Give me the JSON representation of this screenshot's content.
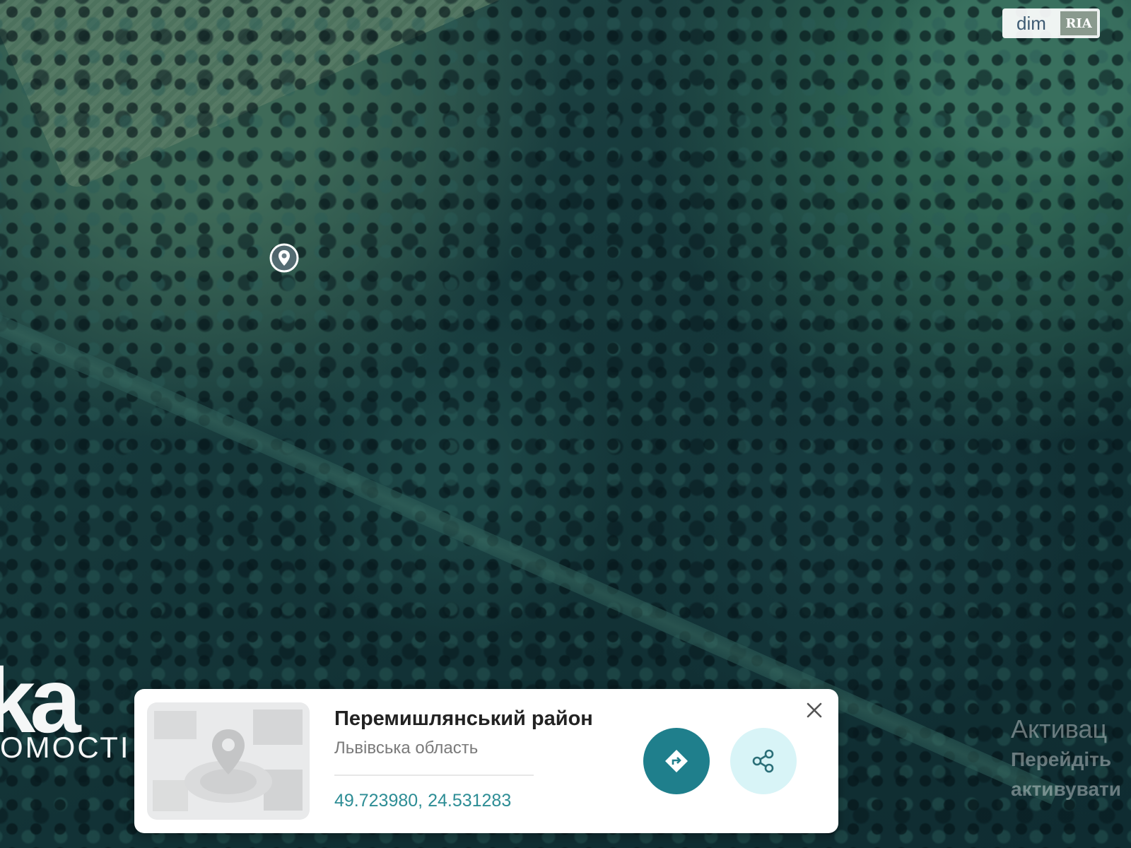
{
  "map": {
    "view": "satellite",
    "marker_icon": "location-pin-icon"
  },
  "watermark": {
    "brand_text": "dim",
    "logo_text": "RIA"
  },
  "overlay_logo": {
    "line1": "ka",
    "line2": "ОМОСТІ"
  },
  "activation_notice": {
    "line1": "Активац",
    "line2": "Перейдіть",
    "line3": "активувати"
  },
  "location_card": {
    "title": "Перемишлянський район",
    "subtitle": "Львівська область",
    "coordinates": "49.723980, 24.531283",
    "thumbnail_icon": "location-illustration",
    "close_icon": "close-icon",
    "route_icon": "directions-icon",
    "share_icon": "share-icon"
  },
  "colors": {
    "accent": "#1f7f8c",
    "accent_light": "#d8f4f7",
    "coords_text": "#2d8d95"
  }
}
